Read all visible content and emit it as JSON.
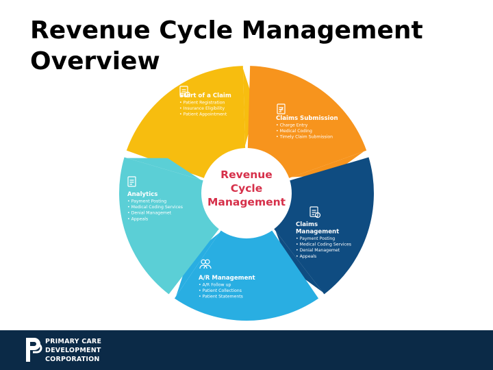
{
  "slide": {
    "title_line1": "Revenue Cycle",
    "title_line2": "Management",
    "title": "Revenue Cycle Management Overview"
  },
  "diagram": {
    "center_lines": [
      "Revenue",
      "Cycle",
      "Management"
    ],
    "center_color": "#d6304a",
    "segments": [
      {
        "id": "start-claim",
        "title_lines": [
          "Start of a Claim"
        ],
        "bullets": [
          "Patient Registration",
          "Insurance Eligibility",
          "Patient Appointment"
        ],
        "color": "#f7bd0f",
        "icon": "document-dollar-icon"
      },
      {
        "id": "claims-submission",
        "title_lines": [
          "Claims Submission"
        ],
        "bullets": [
          "Charge Entry",
          "Medical Coding",
          "Timely Claim Submission"
        ],
        "color": "#f7941d",
        "icon": "clipboard-check-icon"
      },
      {
        "id": "claims-management",
        "title_lines": [
          "Claims",
          "Management"
        ],
        "bullets": [
          "Payment Posting",
          "Medical Coding Services",
          "Denial Managemet",
          "Appeals"
        ],
        "color": "#0f4c81",
        "icon": "document-clock-icon"
      },
      {
        "id": "ar-management",
        "title_lines": [
          "A/R Management"
        ],
        "bullets": [
          "A/R Follow up",
          "Patient Collections",
          "Patient Statements"
        ],
        "color": "#29aee2",
        "icon": "people-icon"
      },
      {
        "id": "analytics",
        "title_lines": [
          "Analytics"
        ],
        "bullets": [
          "Payment Posting",
          "Medical Coding Services",
          "Denial Managemet",
          "Appeals"
        ],
        "color": "#5bcfd6",
        "icon": "report-icon"
      }
    ]
  },
  "footer": {
    "bg_color": "#0b2a47",
    "logo_icon": "pcdc-logo-icon",
    "logo_lines": [
      "PRIMARY CARE",
      "DEVELOPMENT",
      "CORPORATION"
    ]
  }
}
